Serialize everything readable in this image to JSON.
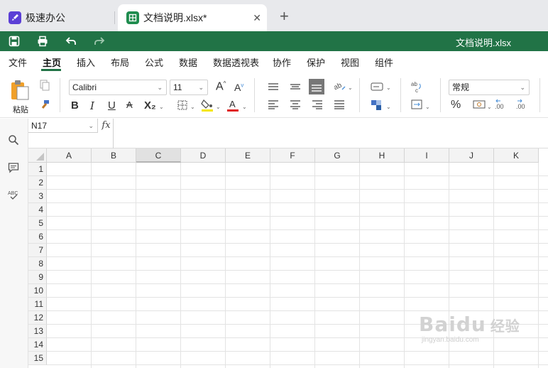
{
  "tabs": [
    {
      "label": "极速办公"
    },
    {
      "label": "文档说明.xlsx*"
    }
  ],
  "title_bar": {
    "title": "文档说明.xlsx"
  },
  "menu": [
    "文件",
    "主页",
    "插入",
    "布局",
    "公式",
    "数据",
    "数据透视表",
    "协作",
    "保护",
    "视图",
    "组件"
  ],
  "active_menu": "主页",
  "ribbon": {
    "paste_label": "粘贴",
    "font_name": "Calibri",
    "font_size": "11",
    "number_format": "常规",
    "bold": "B",
    "italic": "I",
    "underline": "U",
    "strike": "A",
    "subscript": "X₂",
    "percent": "%"
  },
  "formula_bar": {
    "name_box": "N17",
    "fx": "fx",
    "value": ""
  },
  "grid": {
    "columns": [
      "A",
      "B",
      "C",
      "D",
      "E",
      "F",
      "G",
      "H",
      "I",
      "J",
      "K"
    ],
    "selected_column": "C",
    "rows": [
      "1",
      "2",
      "3",
      "4",
      "5",
      "6",
      "7",
      "8",
      "9",
      "10",
      "11",
      "12",
      "13",
      "14",
      "15"
    ]
  },
  "watermark": {
    "brand": "Baidu",
    "sub": "经验",
    "url": "jingyan.baidu.com"
  },
  "colors": {
    "accent": "#217346",
    "tab_bg": "#e8e9ec",
    "grid_line": "#e3e3e3"
  }
}
